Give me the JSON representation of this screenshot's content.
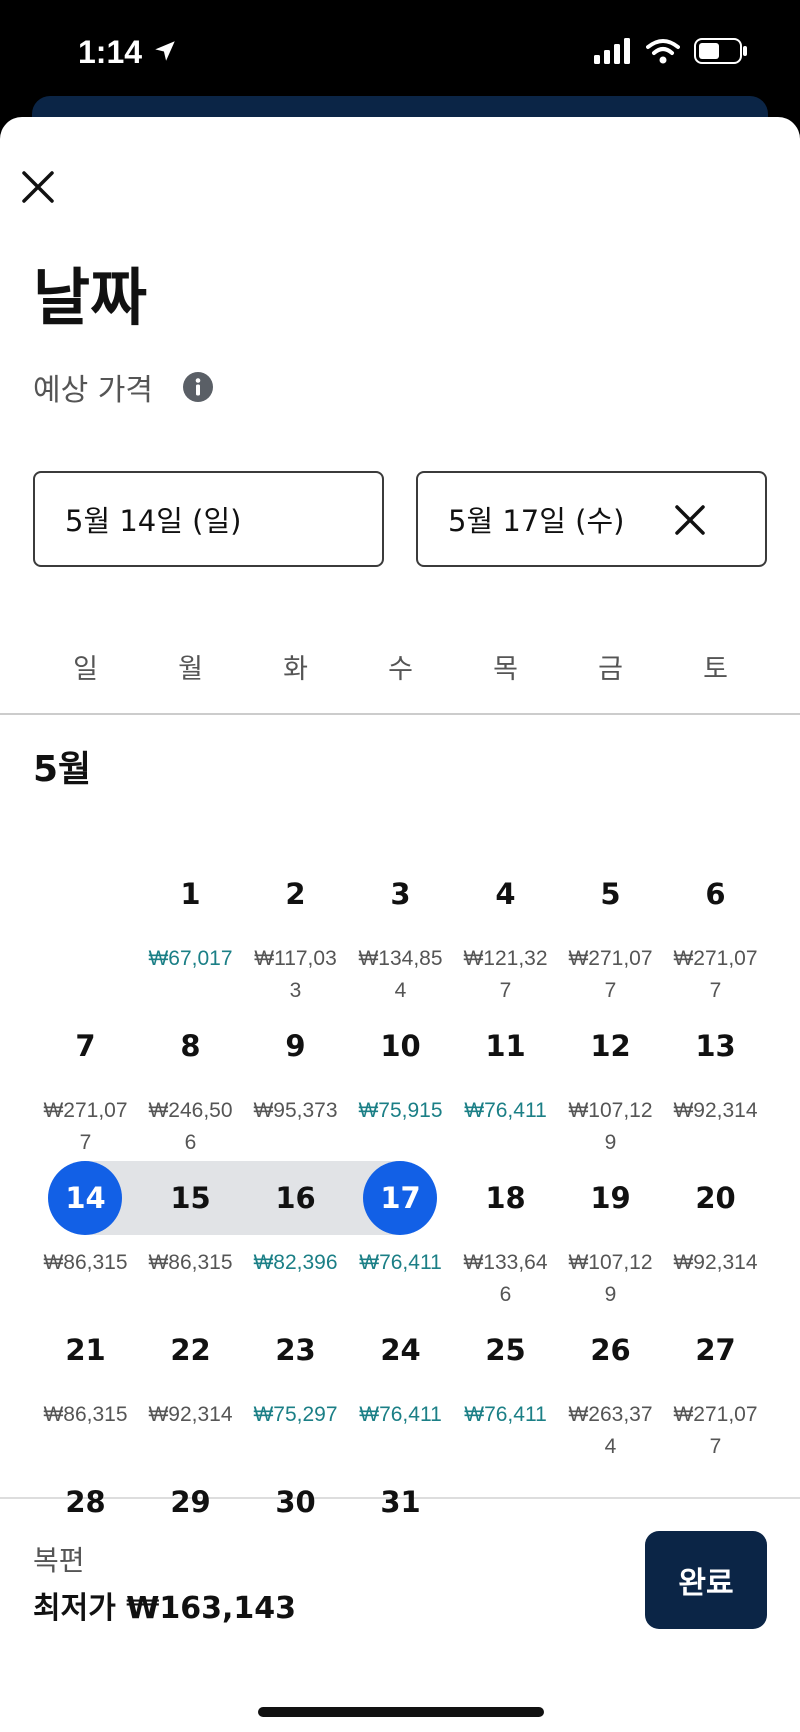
{
  "status_bar": {
    "time": "1:14"
  },
  "header": {
    "title": "날짜",
    "subtitle": "예상 가격"
  },
  "date_range": {
    "start": "5월 14일 (일)",
    "end": "5월 17일 (수)"
  },
  "weekdays": [
    "일",
    "월",
    "화",
    "수",
    "목",
    "금",
    "토"
  ],
  "month": "5월",
  "weeks": [
    [
      {
        "day": "",
        "price": "",
        "low": false
      },
      {
        "day": "1",
        "price": "₩67,017",
        "low": true
      },
      {
        "day": "2",
        "price": "₩117,033",
        "low": false
      },
      {
        "day": "3",
        "price": "₩134,854",
        "low": false
      },
      {
        "day": "4",
        "price": "₩121,327",
        "low": false
      },
      {
        "day": "5",
        "price": "₩271,077",
        "low": false
      },
      {
        "day": "6",
        "price": "₩271,077",
        "low": false
      }
    ],
    [
      {
        "day": "7",
        "price": "₩271,077",
        "low": false
      },
      {
        "day": "8",
        "price": "₩246,506",
        "low": false
      },
      {
        "day": "9",
        "price": "₩95,373",
        "low": false
      },
      {
        "day": "10",
        "price": "₩75,915",
        "low": true
      },
      {
        "day": "11",
        "price": "₩76,411",
        "low": true
      },
      {
        "day": "12",
        "price": "₩107,129",
        "low": false
      },
      {
        "day": "13",
        "price": "₩92,314",
        "low": false
      }
    ],
    [
      {
        "day": "14",
        "price": "₩86,315",
        "low": false
      },
      {
        "day": "15",
        "price": "₩86,315",
        "low": false
      },
      {
        "day": "16",
        "price": "₩82,396",
        "low": true
      },
      {
        "day": "17",
        "price": "₩76,411",
        "low": true
      },
      {
        "day": "18",
        "price": "₩133,646",
        "low": false
      },
      {
        "day": "19",
        "price": "₩107,129",
        "low": false
      },
      {
        "day": "20",
        "price": "₩92,314",
        "low": false
      }
    ],
    [
      {
        "day": "21",
        "price": "₩86,315",
        "low": false
      },
      {
        "day": "22",
        "price": "₩92,314",
        "low": false
      },
      {
        "day": "23",
        "price": "₩75,297",
        "low": true
      },
      {
        "day": "24",
        "price": "₩76,411",
        "low": true
      },
      {
        "day": "25",
        "price": "₩76,411",
        "low": true
      },
      {
        "day": "26",
        "price": "₩263,374",
        "low": false
      },
      {
        "day": "27",
        "price": "₩271,077",
        "low": false
      }
    ],
    [
      {
        "day": "28",
        "price": "",
        "low": false
      },
      {
        "day": "29",
        "price": "",
        "low": false
      },
      {
        "day": "30",
        "price": "",
        "low": false
      },
      {
        "day": "31",
        "price": "",
        "low": false
      },
      {
        "day": "",
        "price": "",
        "low": false
      },
      {
        "day": "",
        "price": "",
        "low": false
      },
      {
        "day": "",
        "price": "",
        "low": false
      }
    ]
  ],
  "selected_days": [
    "14",
    "17"
  ],
  "in_range_days": [
    "15",
    "16"
  ],
  "footer": {
    "fare_type": "복편",
    "lowest_price": "최저가 ₩163,143",
    "done_label": "완료"
  },
  "colors": {
    "accent": "#1260e6",
    "low_price": "#1b7f86",
    "button_bg": "#0b2546"
  }
}
